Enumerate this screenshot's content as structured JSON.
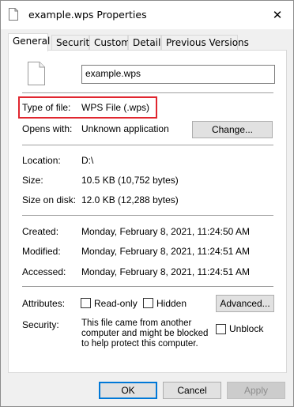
{
  "window": {
    "title": "example.wps Properties",
    "close_glyph": "✕"
  },
  "tabs": [
    {
      "label": "General"
    },
    {
      "label": "Security"
    },
    {
      "label": "Custom"
    },
    {
      "label": "Details"
    },
    {
      "label": "Previous Versions"
    }
  ],
  "general": {
    "file_name": "example.wps",
    "type_of_file_label": "Type of file:",
    "type_of_file_value": "WPS File (.wps)",
    "opens_with_label": "Opens with:",
    "opens_with_value": "Unknown application",
    "change_button": "Change...",
    "location_label": "Location:",
    "location_value": "D:\\",
    "size_label": "Size:",
    "size_value": "10.5 KB (10,752 bytes)",
    "size_on_disk_label": "Size on disk:",
    "size_on_disk_value": "12.0 KB (12,288 bytes)",
    "created_label": "Created:",
    "created_value": "Monday, February 8, 2021, 11:24:50 AM",
    "modified_label": "Modified:",
    "modified_value": "Monday, February 8, 2021, 11:24:51 AM",
    "accessed_label": "Accessed:",
    "accessed_value": "Monday, February 8, 2021, 11:24:51 AM",
    "attributes_label": "Attributes:",
    "readonly_label": "Read-only",
    "hidden_label": "Hidden",
    "advanced_button": "Advanced...",
    "security_label": "Security:",
    "security_text": "This file came from another computer and might be blocked to help protect this computer.",
    "unblock_label": "Unblock"
  },
  "footer": {
    "ok": "OK",
    "cancel": "Cancel",
    "apply": "Apply"
  },
  "colors": {
    "highlight": "#e0262f",
    "default_button_border": "#0078d7"
  },
  "icons": {
    "title": "document-icon",
    "file": "document-icon",
    "close": "close-icon"
  }
}
